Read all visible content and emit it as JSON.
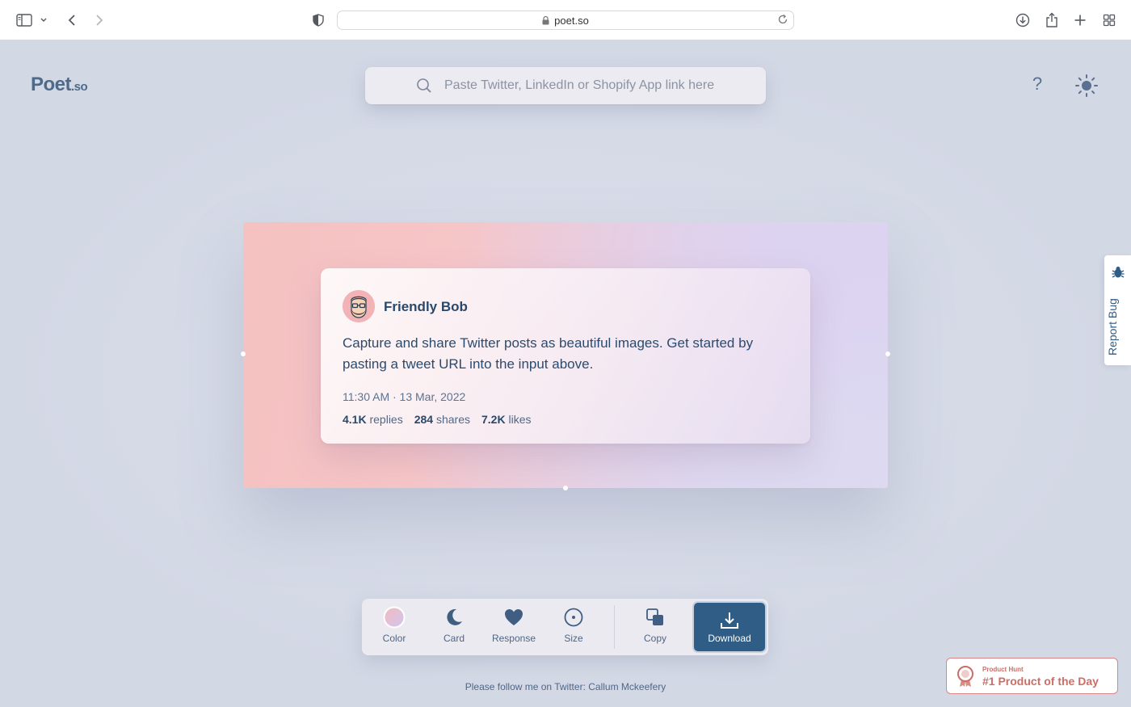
{
  "browser": {
    "url": "poet.so"
  },
  "brand": {
    "logo_main": "Poet",
    "logo_suffix": ".so"
  },
  "search": {
    "placeholder": "Paste Twitter, LinkedIn or Shopify App link here",
    "value": ""
  },
  "header": {
    "help_label": "?"
  },
  "tweet": {
    "author": "Friendly Bob",
    "text": "Capture and share Twitter posts as beautiful images. Get started by pasting a tweet URL into the input above.",
    "timestamp": "11:30 AM · 13 Mar, 2022",
    "replies_count": "4.1K",
    "replies_label": "replies",
    "shares_count": "284",
    "shares_label": "shares",
    "likes_count": "7.2K",
    "likes_label": "likes"
  },
  "toolbar": {
    "color_label": "Color",
    "card_label": "Card",
    "response_label": "Response",
    "size_label": "Size",
    "copy_label": "Copy",
    "download_label": "Download"
  },
  "footer": {
    "text": "Please follow me on Twitter: Callum Mckeefery"
  },
  "report_bug": {
    "label": "Report Bug"
  },
  "product_hunt": {
    "small": "Product Hunt",
    "big": "#1 Product of the Day"
  },
  "colors": {
    "accent": "#2f5d86",
    "page_bg": "#d5dae6",
    "canvas_left": "#f5c1c1",
    "canvas_right": "#dcd6f2",
    "product_hunt": "#cc6e67"
  }
}
